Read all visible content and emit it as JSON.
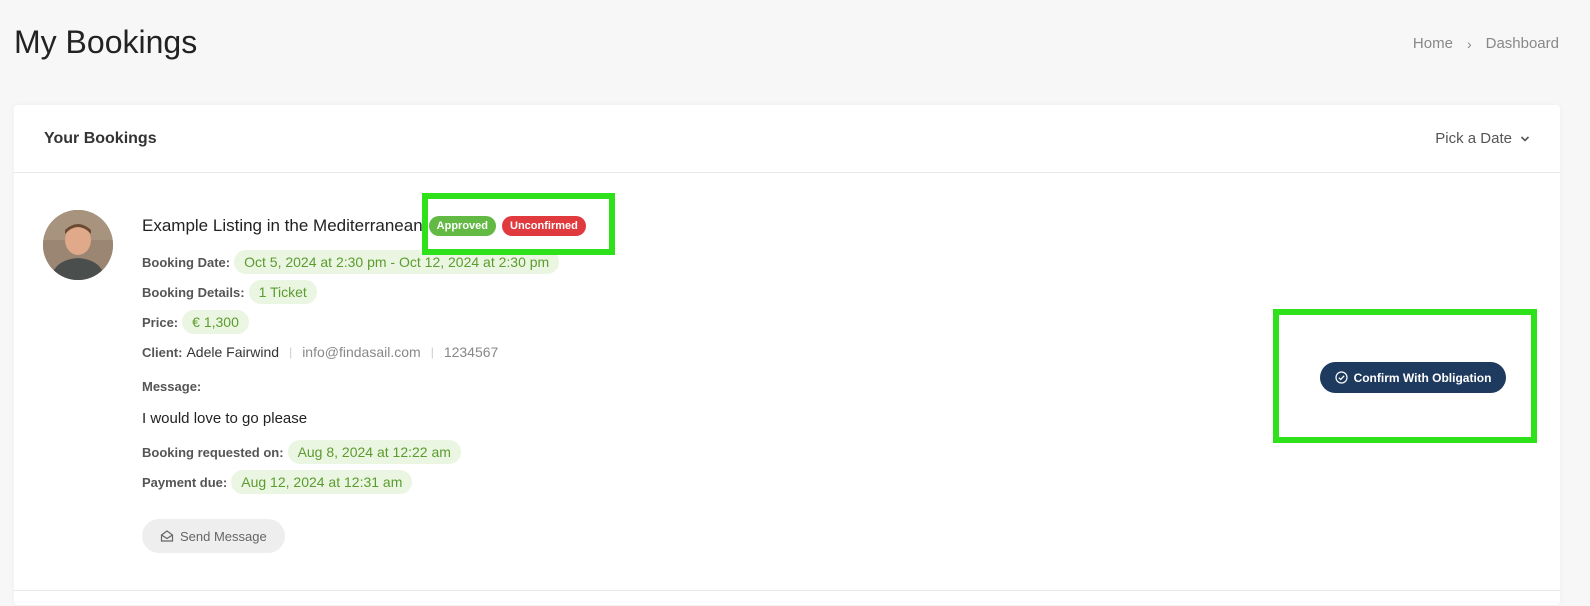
{
  "page": {
    "title": "My Bookings"
  },
  "breadcrumb": {
    "home": "Home",
    "separator": "›",
    "current": "Dashboard"
  },
  "card": {
    "title": "Your Bookings",
    "date_picker_label": "Pick a Date"
  },
  "booking": {
    "listing_title": "Example Listing in the Mediterranean",
    "badges": {
      "approved": "Approved",
      "unconfirmed": "Unconfirmed"
    },
    "booking_date_label": "Booking Date:",
    "booking_date": "Oct 5, 2024 at 2:30 pm - Oct 12, 2024 at 2:30 pm",
    "details_label": "Booking Details:",
    "details": "1 Ticket",
    "price_label": "Price:",
    "price": "€ 1,300",
    "client_label": "Client:",
    "client_name": "Adele Fairwind",
    "client_email": "info@findasail.com",
    "client_phone": "1234567",
    "message_label": "Message:",
    "message": "I would love to go please",
    "requested_label": "Booking requested on:",
    "requested_on": "Aug 8, 2024 at 12:22 am",
    "payment_label": "Payment due:",
    "payment_due": "Aug 12, 2024 at 12:31 am",
    "send_message_label": "Send Message",
    "confirm_label": "Confirm With Obligation"
  },
  "colors": {
    "approved": "#62b944",
    "unconfirmed": "#e03a3e",
    "confirm_button": "#1f3a5f",
    "highlight": "#2ee11a",
    "pill_bg": "#eaf6e1",
    "pill_text": "#5c9b2f"
  }
}
